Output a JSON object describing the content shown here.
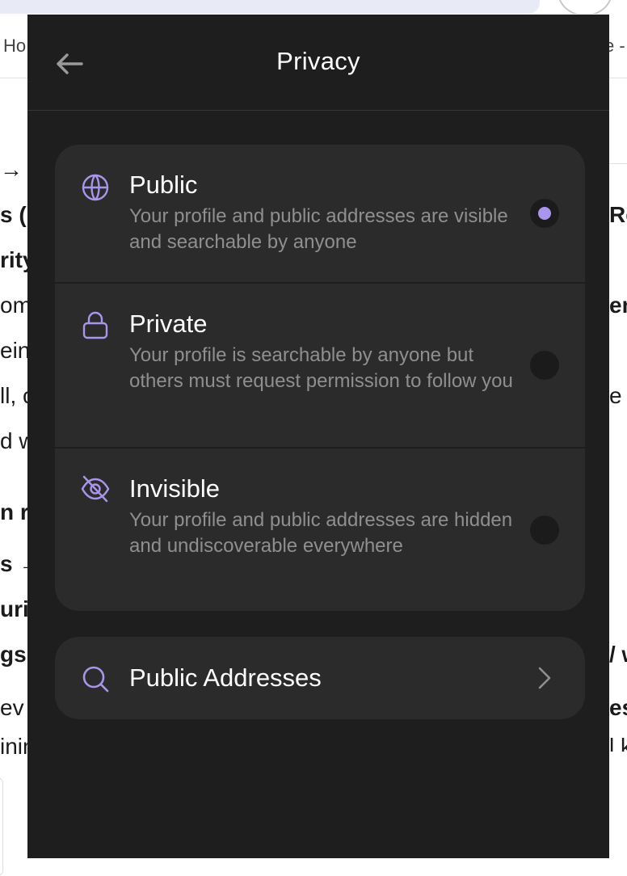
{
  "background": {
    "nav_left_fragment": "Ho",
    "nav_right_fragment": "e -",
    "left_fragments": [
      "→ g",
      "s (",
      "rity",
      "om",
      "ein",
      "ll, c",
      "d w",
      "n r",
      "s →",
      "urit",
      "gs",
      "ev",
      "inin"
    ],
    "right_fragments": [
      "Re",
      "em",
      "e",
      "/ w",
      "es",
      "l k"
    ]
  },
  "header": {
    "title": "Privacy",
    "back_icon": "arrow-left-icon"
  },
  "privacy_options": [
    {
      "title": "Public",
      "description": "Your profile and public addresses are visible and searchable by anyone",
      "icon": "globe-icon",
      "selected": true
    },
    {
      "title": "Private",
      "description": "Your profile is searchable by anyone but others must request permission to follow you",
      "icon": "lock-icon",
      "selected": false
    },
    {
      "title": "Invisible",
      "description": "Your profile and public addresses are hidden and undiscoverable everywhere",
      "icon": "eye-off-icon",
      "selected": false
    }
  ],
  "public_addresses": {
    "label": "Public Addresses",
    "icon": "search-icon",
    "chevron_icon": "chevron-right-icon"
  },
  "colors": {
    "panel_background": "#1e1e1e",
    "card_background": "#2b2b2b",
    "accent": "#a996ec",
    "secondary_text": "#8f8f8f"
  }
}
